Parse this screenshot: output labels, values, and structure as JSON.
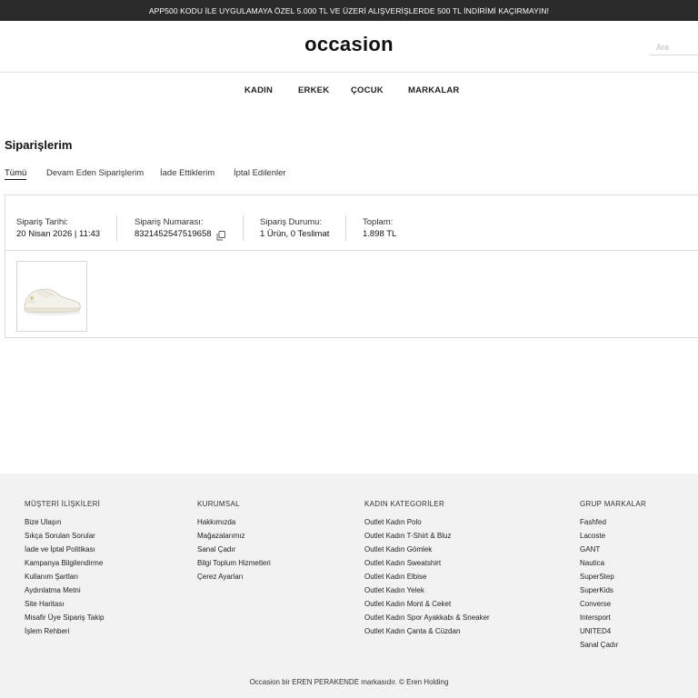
{
  "promo": {
    "text": "APP500 KODU İLE UYGULAMAYA ÖZEL 5.000 TL VE ÜZERİ ALIŞVERİŞLERDE 500 TL İNDİRİMİ KAÇIRMAYIN!"
  },
  "header": {
    "logo": "occasion",
    "search_placeholder": "Ara"
  },
  "nav": {
    "items": [
      "KADIN",
      "ERKEK",
      "ÇOCUK",
      "MARKALAR"
    ]
  },
  "orders_page": {
    "title": "Siparişlerim",
    "tabs": [
      "Tümü",
      "Devam Eden Siparişlerim",
      "İade Ettiklerim",
      "İptal Edilenler"
    ],
    "active_tab": "Tümü"
  },
  "order": {
    "date_label": "Sipariş Tarihi:",
    "date_value": "20 Nisan 2026 | 11:43",
    "number_label": "Sipariş Numarası:",
    "number_value": "8321452547519658",
    "status_label": "Sipariş Durumu:",
    "status_value": "1 Ürün, 0 Teslimat",
    "total_label": "Toplam:",
    "total_value": "1.898 TL",
    "copy_icon": "copy-icon",
    "product_image": "white-sneaker"
  },
  "footer": {
    "columns": [
      {
        "title": "MÜŞTERİ İLİŞKİLERİ",
        "links": [
          "Bize Ulaşın",
          "Sıkça Sorulan Sorular",
          "İade ve İptal Politikası",
          "Kampanya Bilgilendirme",
          "Kullanım Şartları",
          "Aydınlatma Metni",
          "Site Haritası",
          "Misafir Üye Sipariş Takip",
          "İşlem Rehberi"
        ]
      },
      {
        "title": "KURUMSAL",
        "links": [
          "Hakkımızda",
          "Mağazalarımız",
          "Sanal Çadır",
          "Bilgi Toplum Hizmetleri",
          "Çerez Ayarları"
        ]
      },
      {
        "title": "KADIN KATEGORİLER",
        "links": [
          "Outlet Kadın Polo",
          "Outlet Kadın T-Shirt & Bluz",
          "Outlet Kadın Gömlek",
          "Outlet Kadın Sweatshirt",
          "Outlet Kadın Elbise",
          "Outlet Kadın Yelek",
          "Outlet Kadın Mont & Ceket",
          "Outlet Kadın Spor Ayakkabı & Sneaker",
          "Outlet Kadın Çanta & Cüzdan"
        ]
      },
      {
        "title": "GRUP MARKALAR",
        "links": [
          "Fashfed",
          "Lacoste",
          "GANT",
          "Nautica",
          "SuperStep",
          "SuperKids",
          "Converse",
          "Intersport",
          "UNITED4",
          "Sanal Çadır"
        ]
      }
    ],
    "copyright": "Occasion bir EREN PERAKENDE markasıdır. © Eren Holding"
  }
}
